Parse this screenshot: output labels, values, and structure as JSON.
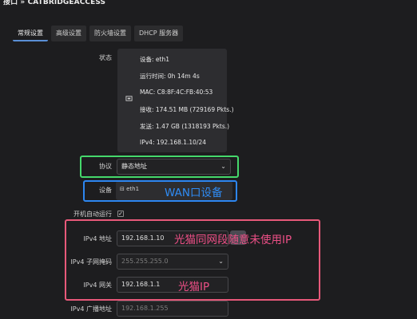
{
  "window": {
    "title": "接口 » CATBRIDGEACCESS"
  },
  "tabs": [
    "常规设置",
    "高级设置",
    "防火墙设置",
    "DHCP 服务器"
  ],
  "status": {
    "label": "状态",
    "icon": "ethernet-port-icon",
    "device": "设备: eth1",
    "uptime": "运行时间: 0h 14m 4s",
    "mac": "MAC: C8:8F:4C:FB:40:53",
    "rx": "接收: 174.51 MB (729169 Pkts.)",
    "tx": "发送: 1.47 GB (1318193 Pkts.)",
    "ipv4": "IPv4: 192.168.1.10/24"
  },
  "protocol": {
    "label": "协议",
    "value": "静态地址"
  },
  "device": {
    "label": "设备",
    "value": "eth1"
  },
  "autostart": {
    "label": "开机自动运行",
    "checked": true
  },
  "ipv4_address": {
    "label": "IPv4 地址",
    "value": "192.168.1.10"
  },
  "ipv4_netmask": {
    "label": "IPv4 子网掩码",
    "placeholder": "255.255.255.0"
  },
  "ipv4_gateway": {
    "label": "IPv4 网关",
    "value": "192.168.1.1"
  },
  "ipv4_broadcast": {
    "label": "IPv4 广播地址",
    "placeholder": "192.168.1.255"
  },
  "annotations": {
    "wan": "WAN口设备",
    "same_segment": "光猫同网段随意未使用IP",
    "gateway": "光猫IP"
  },
  "colors": {
    "accent": "#5a8fd6",
    "highlight_green": "#45d86b",
    "highlight_blue": "#2d86f0",
    "highlight_red": "#e8597a",
    "annotation_pink": "#ec4f86"
  }
}
